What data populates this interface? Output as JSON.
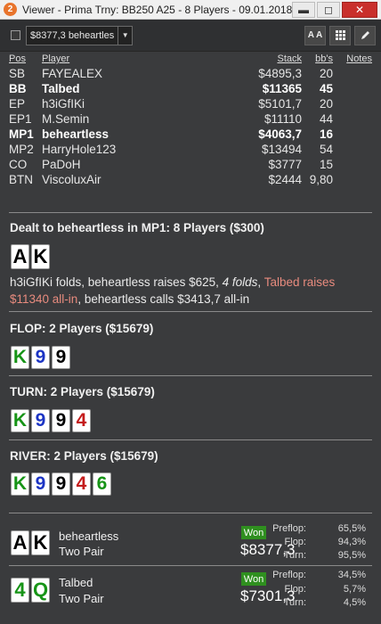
{
  "window": {
    "app_icon": "2",
    "title": "Viewer - Prima Trny: BB250 A25 - 8 Players - 09.01.2018 22:06",
    "minimize": "▬",
    "maximize": "◻",
    "close": "✕"
  },
  "toolbar": {
    "hand_select_value": "$8377,3 beheartles",
    "font_button": "A A",
    "grid_button_icon": "grid-icon",
    "edit_button_icon": "pencil-icon"
  },
  "players": {
    "headers": {
      "pos": "Pos",
      "player": "Player",
      "stack": "Stack",
      "bbs": "bb's",
      "notes": "Notes"
    },
    "rows": [
      {
        "pos": "SB",
        "player": "FAYEALEX",
        "stack": "$4895,3",
        "bbs": "20"
      },
      {
        "pos": "BB",
        "player": "Talbed",
        "stack": "$11365",
        "bbs": "45"
      },
      {
        "pos": "EP",
        "player": "h3iGfIKi",
        "stack": "$5101,7",
        "bbs": "20"
      },
      {
        "pos": "EP1",
        "player": "M.Semin",
        "stack": "$11110",
        "bbs": "44"
      },
      {
        "pos": "MP1",
        "player": "beheartless",
        "stack": "$4063,7",
        "bbs": "16"
      },
      {
        "pos": "MP2",
        "player": "HarryHole123",
        "stack": "$13494",
        "bbs": "54"
      },
      {
        "pos": "CO",
        "player": "PaDoH",
        "stack": "$3777",
        "bbs": "15"
      },
      {
        "pos": "BTN",
        "player": "ViscoluxAir",
        "stack": "$2444",
        "bbs": "9,80"
      }
    ]
  },
  "preflop": {
    "title": "Dealt to beheartless in MP1: 8 Players ($300)",
    "cards": [
      "A",
      "K"
    ],
    "action_1": "h3iGfIKi folds, beheartless raises $625, ",
    "action_2": "4 folds",
    "action_3": ", ",
    "action_4": "Talbed raises $11340 all-in",
    "action_5": ", beheartless calls $3413,7 all-in"
  },
  "flop": {
    "title": "FLOP: 2 Players ($15679)",
    "cards": [
      "K",
      "9",
      "9"
    ]
  },
  "turn": {
    "title": "TURN: 2 Players ($15679)",
    "cards": [
      "K",
      "9",
      "9",
      "4"
    ]
  },
  "river": {
    "title": "RIVER: 2 Players ($15679)",
    "cards": [
      "K",
      "9",
      "9",
      "4",
      "6"
    ]
  },
  "results": [
    {
      "cards": [
        "A",
        "K"
      ],
      "name": "beheartless",
      "hand": "Two Pair",
      "badge": "Won",
      "amount": "$8377,3",
      "stats": [
        {
          "label": "Preflop:",
          "value": "65,5%"
        },
        {
          "label": "Flop:",
          "value": "94,3%"
        },
        {
          "label": "Turn:",
          "value": "95,5%"
        }
      ]
    },
    {
      "cards": [
        "4",
        "Q"
      ],
      "name": "Talbed",
      "hand": "Two Pair",
      "badge": "Won",
      "amount": "$7301,3",
      "stats": [
        {
          "label": "Preflop:",
          "value": "34,5%"
        },
        {
          "label": "Flop:",
          "value": "5,7%"
        },
        {
          "label": "Turn:",
          "value": "4,5%"
        }
      ]
    }
  ],
  "suit_colors": {
    "spades": "#000000",
    "clubs": "#179417",
    "diamonds": "#1c34c4",
    "hearts": "#c41c1c"
  }
}
